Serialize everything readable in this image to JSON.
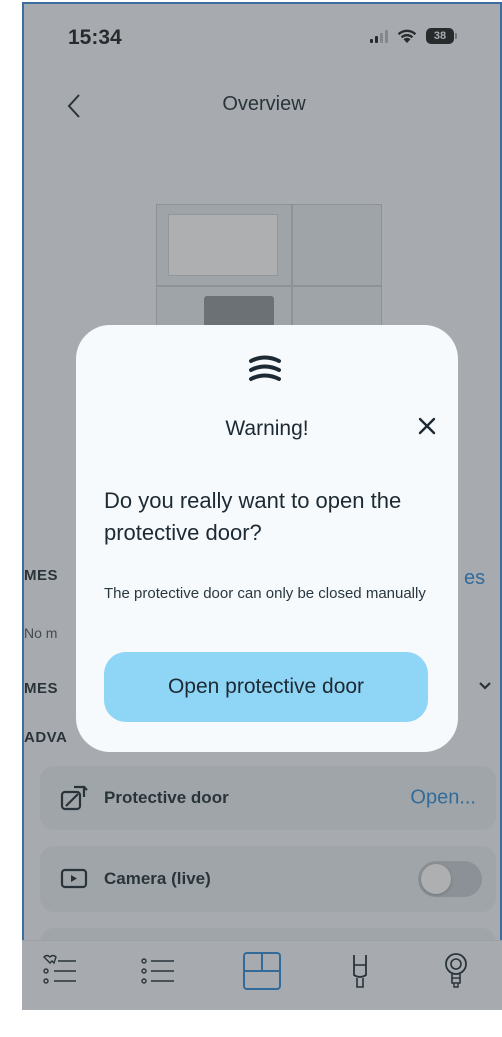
{
  "status_bar": {
    "time": "15:34",
    "battery": "38"
  },
  "nav": {
    "title": "Overview"
  },
  "background": {
    "section_1_label": "MES",
    "section_1_link": "es",
    "section_1_text": "No m",
    "section_2_label": "MES",
    "section_3_label": "ADVA",
    "cards": [
      {
        "label": "Protective door",
        "action": "Open...",
        "icon": "door-open-icon"
      },
      {
        "label": "Camera (live)",
        "icon": "camera-live-icon",
        "toggle": false
      }
    ]
  },
  "tabs": [
    {
      "icon": "tooth-list-icon"
    },
    {
      "icon": "list-icon"
    },
    {
      "icon": "device-icon",
      "active": true
    },
    {
      "icon": "tool-icon"
    },
    {
      "icon": "bulb-icon"
    }
  ],
  "modal": {
    "title": "Warning!",
    "question": "Do you really want to open the protective door?",
    "note": "The protective door can only be closed manually",
    "button_label": "Open protective door"
  },
  "colors": {
    "accent": "#2b8bd8",
    "button": "#8fd6f6",
    "text": "#1d2a33"
  }
}
